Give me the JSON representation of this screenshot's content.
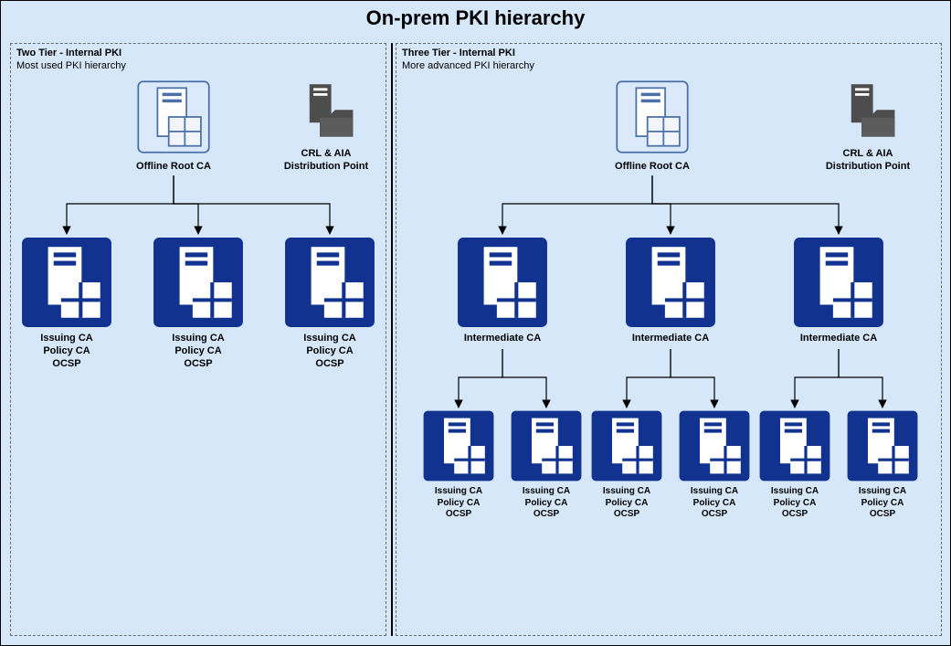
{
  "title": "On-prem PKI hierarchy",
  "left_panel": {
    "heading_bold": "Two Tier - Internal PKI",
    "heading_sub": "Most used PKI hierarchy",
    "root_label": "Offline Root CA",
    "dp_label_line1": "CRL & AIA",
    "dp_label_line2": "Distribution Point",
    "issuing": [
      {
        "line1": "Issuing CA",
        "line2": "Policy CA",
        "line3": "OCSP"
      },
      {
        "line1": "Issuing CA",
        "line2": "Policy CA",
        "line3": "OCSP"
      },
      {
        "line1": "Issuing CA",
        "line2": "Policy CA",
        "line3": "OCSP"
      }
    ]
  },
  "right_panel": {
    "heading_bold": "Three Tier - Internal PKI",
    "heading_sub": "More advanced PKI hierarchy",
    "root_label": "Offline Root CA",
    "dp_label_line1": "CRL & AIA",
    "dp_label_line2": "Distribution Point",
    "intermediate": [
      {
        "label": "Intermediate CA"
      },
      {
        "label": "Intermediate CA"
      },
      {
        "label": "Intermediate CA"
      }
    ],
    "issuing": [
      {
        "line1": "Issuing CA",
        "line2": "Policy CA",
        "line3": "OCSP"
      },
      {
        "line1": "Issuing CA",
        "line2": "Policy CA",
        "line3": "OCSP"
      },
      {
        "line1": "Issuing CA",
        "line2": "Policy CA",
        "line3": "OCSP"
      },
      {
        "line1": "Issuing CA",
        "line2": "Policy CA",
        "line3": "OCSP"
      },
      {
        "line1": "Issuing CA",
        "line2": "Policy CA",
        "line3": "OCSP"
      },
      {
        "line1": "Issuing CA",
        "line2": "Policy CA",
        "line3": "OCSP"
      }
    ]
  },
  "colors": {
    "canvas_bg": "#d6e7fa",
    "root_fill": "#dbe9fb",
    "root_stroke": "#4a70a8",
    "ca_fill": "#11328f",
    "dp_fill": "#4d4d4d"
  }
}
